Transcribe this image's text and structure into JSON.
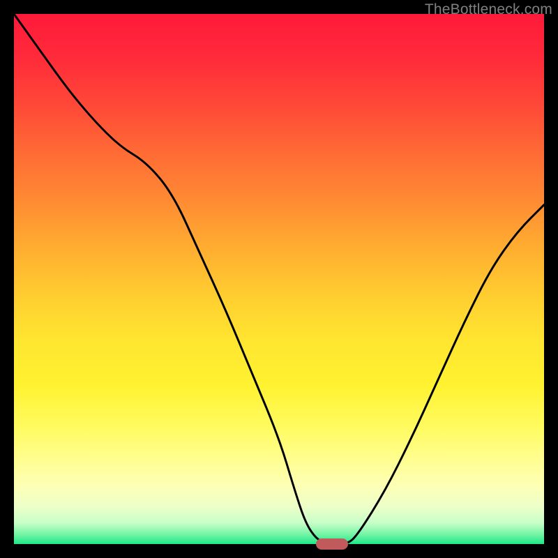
{
  "attribution": "TheBottleneck.com",
  "colors": {
    "background": "#000000",
    "gradient_top": "#ff1a3a",
    "gradient_bottom": "#1de888",
    "curve": "#000000",
    "marker": "#c15a5a",
    "attribution_text": "#808080"
  },
  "chart_data": {
    "type": "line",
    "title": "",
    "xlabel": "",
    "ylabel": "",
    "xlim": [
      0,
      100
    ],
    "ylim": [
      0,
      100
    ],
    "x": [
      0,
      5,
      10,
      15,
      20,
      25,
      30,
      35,
      40,
      45,
      50,
      53,
      55,
      57,
      59,
      60,
      63,
      65,
      70,
      75,
      80,
      85,
      90,
      95,
      100
    ],
    "values": [
      100,
      93,
      86,
      80,
      75,
      72,
      66,
      55,
      44,
      32,
      20,
      10,
      4,
      1,
      0,
      0,
      0,
      2,
      10,
      20,
      31,
      42,
      52,
      59,
      64
    ],
    "flat_segment": {
      "x_start": 57,
      "x_end": 63,
      "y": 0
    },
    "marker": {
      "x_center": 60,
      "y": 0,
      "width_pct": 6,
      "height_pct": 2
    },
    "notes": "y represents distance from bottom (0 = green baseline, 100 = top). Curve is a V-shape with kink on left branch near x≈20-25 and flat bottom around x≈57-63."
  }
}
